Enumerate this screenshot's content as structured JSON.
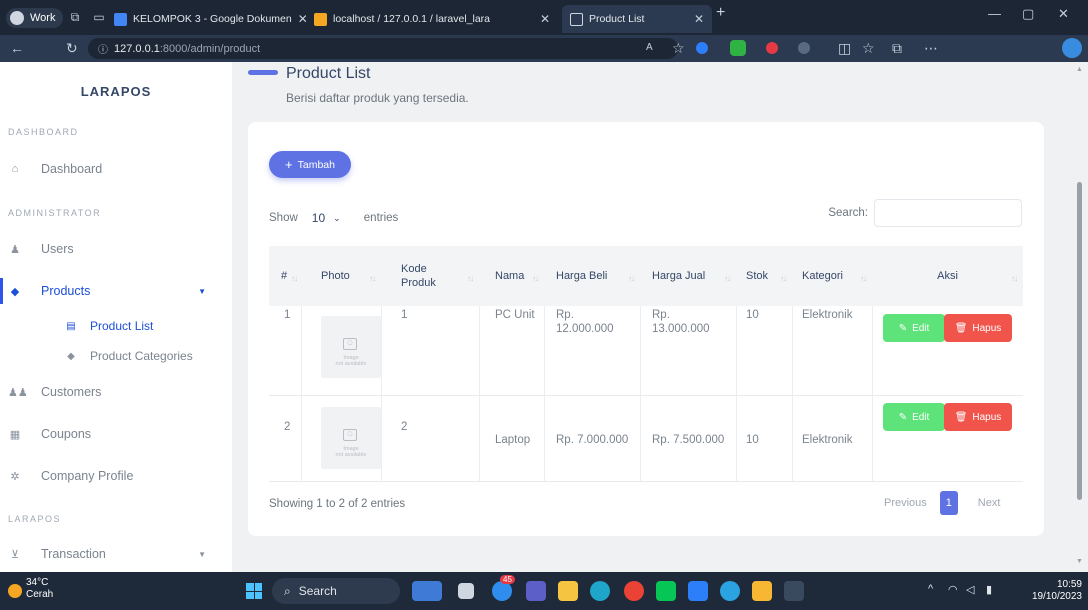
{
  "browser": {
    "profile": "Work",
    "tabs": [
      {
        "label": "KELOMPOK 3 - Google Dokumen",
        "color": "#4285f4"
      },
      {
        "label": "localhost / 127.0.0.1 / laravel_lara",
        "color": "#f5a623"
      },
      {
        "label": "Product List",
        "color": "#cfd6e0"
      }
    ],
    "url_host": "127.0.0.1",
    "url_path": ":8000/admin/product"
  },
  "sidebar": {
    "brand": "LARAPOS",
    "sections": {
      "dashboard": "DASHBOARD",
      "administrator": "ADMINISTRATOR",
      "larapos": "LARAPOS"
    },
    "items": {
      "dashboard": "Dashboard",
      "users": "Users",
      "products": "Products",
      "product_list": "Product List",
      "product_categories": "Product Categories",
      "customers": "Customers",
      "coupons": "Coupons",
      "company_profile": "Company Profile",
      "transaction": "Transaction"
    }
  },
  "page": {
    "title": "Product List",
    "subtitle": "Berisi daftar produk yang tersedia.",
    "add_button": "Tambah",
    "show_label": "Show",
    "entries_value": "10",
    "entries_label": "entries",
    "search_label": "Search:",
    "showing": "Showing 1 to 2 of 2 entries",
    "prev": "Previous",
    "page_num": "1",
    "next": "Next"
  },
  "table": {
    "headers": {
      "num": "#",
      "photo": "Photo",
      "kode_1": "Kode",
      "kode_2": "Produk",
      "nama": "Nama",
      "harga_beli": "Harga Beli",
      "harga_jual": "Harga Jual",
      "stok": "Stok",
      "kategori": "Kategori",
      "aksi": "Aksi"
    },
    "rows": [
      {
        "num": "1",
        "img_1": "Image",
        "img_2": "not available",
        "kode": "1",
        "nama": "PC Unit",
        "beli_1": "Rp.",
        "beli_2": "12.000.000",
        "jual_1": "Rp.",
        "jual_2": "13.000.000",
        "stok": "10",
        "kategori": "Elektronik"
      },
      {
        "num": "2",
        "img_1": "Image",
        "img_2": "not available",
        "kode": "2",
        "nama": "Laptop",
        "beli_1": "Rp. 7.000.000",
        "beli_2": "",
        "jual_1": "Rp. 7.500.000",
        "jual_2": "",
        "stok": "10",
        "kategori": "Elektronik"
      }
    ],
    "edit_label": "Edit",
    "delete_label": "Hapus"
  },
  "taskbar": {
    "temp": "34°C",
    "weather": "Cerah",
    "search": "Search",
    "badge": "45",
    "time": "10:59",
    "date": "19/10/2023"
  },
  "colors": {
    "primary": "#5e72e4",
    "edit": "#5ee27a",
    "delete": "#f0544b",
    "active_nav": "#1d4fd8"
  }
}
